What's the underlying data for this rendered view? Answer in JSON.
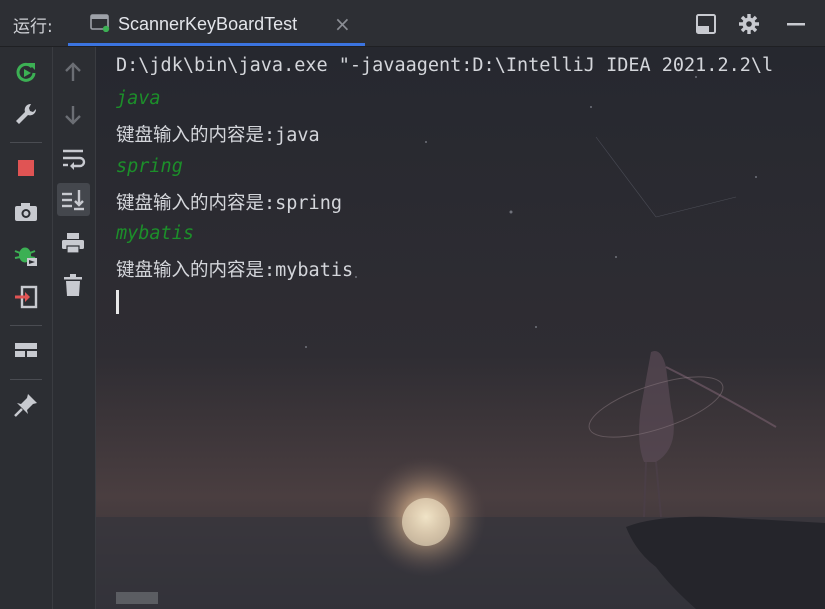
{
  "run_panel": {
    "label": "运行:",
    "tab": {
      "title": "ScannerKeyBoardTest",
      "close_glyph": "×",
      "icon": "console-run-icon"
    },
    "top_actions": [
      "layout-icon",
      "gear-icon",
      "minimize-icon"
    ]
  },
  "toolbar_primary": [
    "rerun-icon",
    "wrench-icon",
    "stop-icon",
    "camera-icon",
    "debug-bug-icon",
    "exit-icon",
    "layout-grid-icon",
    "pin-icon"
  ],
  "toolbar_secondary": [
    "arrow-up-icon",
    "arrow-down-icon",
    "soft-wrap-icon",
    "scroll-to-end-icon",
    "print-icon",
    "trash-icon"
  ],
  "colors": {
    "accent": "#3b74e0",
    "input_text": "#1c8f2a",
    "stop_red": "#e05454",
    "run_green": "#3cb054"
  },
  "console": {
    "lines": [
      {
        "kind": "cmd",
        "text": "D:\\jdk\\bin\\java.exe \"-javaagent:D:\\IntelliJ IDEA 2021.2.2\\l"
      },
      {
        "kind": "input",
        "text": "java"
      },
      {
        "kind": "out",
        "text": "键盘输入的内容是:java"
      },
      {
        "kind": "input",
        "text": "spring"
      },
      {
        "kind": "out",
        "text": "键盘输入的内容是:spring"
      },
      {
        "kind": "input",
        "text": "mybatis"
      },
      {
        "kind": "out",
        "text": "键盘输入的内容是:mybatis"
      }
    ]
  }
}
